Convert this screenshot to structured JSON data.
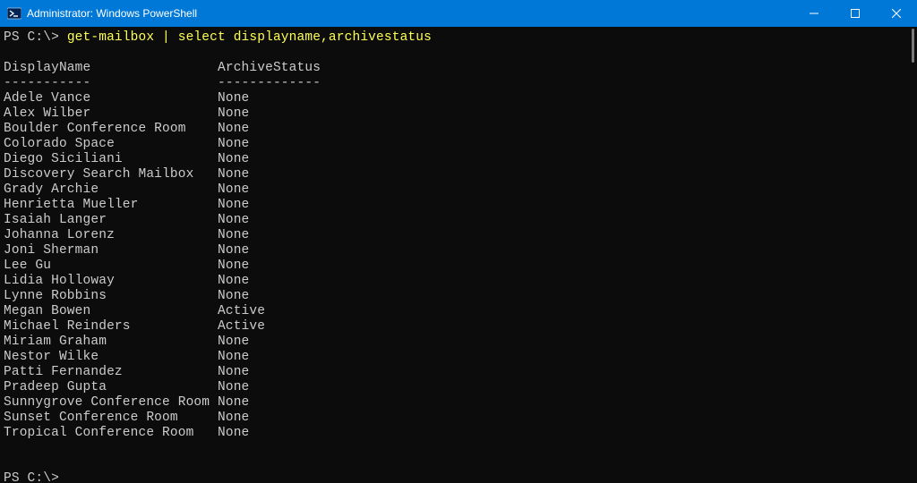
{
  "titlebar": {
    "title": "Administrator: Windows PowerShell"
  },
  "prompt": {
    "ps": "PS",
    "path": "C:\\>",
    "command": "get-mailbox | select displayname,archivestatus"
  },
  "headers": {
    "displayName": "DisplayName",
    "archiveStatus": "ArchiveStatus",
    "dashDisplay": "-----------",
    "dashArchive": "-------------"
  },
  "rows": [
    {
      "name": "Adele Vance",
      "status": "None"
    },
    {
      "name": "Alex Wilber",
      "status": "None"
    },
    {
      "name": "Boulder Conference Room",
      "status": "None"
    },
    {
      "name": "Colorado Space",
      "status": "None"
    },
    {
      "name": "Diego Siciliani",
      "status": "None"
    },
    {
      "name": "Discovery Search Mailbox",
      "status": "None"
    },
    {
      "name": "Grady Archie",
      "status": "None"
    },
    {
      "name": "Henrietta Mueller",
      "status": "None"
    },
    {
      "name": "Isaiah Langer",
      "status": "None"
    },
    {
      "name": "Johanna Lorenz",
      "status": "None"
    },
    {
      "name": "Joni Sherman",
      "status": "None"
    },
    {
      "name": "Lee Gu",
      "status": "None"
    },
    {
      "name": "Lidia Holloway",
      "status": "None"
    },
    {
      "name": "Lynne Robbins",
      "status": "None"
    },
    {
      "name": "Megan Bowen",
      "status": "Active"
    },
    {
      "name": "Michael Reinders",
      "status": "Active"
    },
    {
      "name": "Miriam Graham",
      "status": "None"
    },
    {
      "name": "Nestor Wilke",
      "status": "None"
    },
    {
      "name": "Patti Fernandez",
      "status": "None"
    },
    {
      "name": "Pradeep Gupta",
      "status": "None"
    },
    {
      "name": "Sunnygrove Conference Room",
      "status": "None"
    },
    {
      "name": "Sunset Conference Room",
      "status": "None"
    },
    {
      "name": "Tropical Conference Room",
      "status": "None"
    }
  ],
  "trailingPrompt": {
    "ps": "PS",
    "path": "C:\\>"
  },
  "layout": {
    "nameColWidth": 27
  }
}
